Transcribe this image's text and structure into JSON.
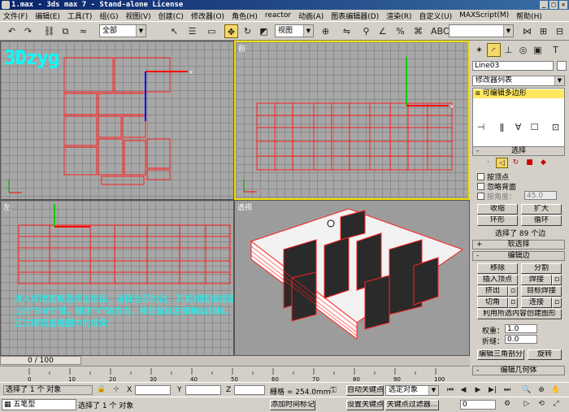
{
  "window": {
    "title": "1.max - 3ds max 7 - Stand-alone License"
  },
  "menu": [
    "文件(F)",
    "编辑(E)",
    "工具(T)",
    "组(G)",
    "视图(V)",
    "创建(C)",
    "修改器(O)",
    "角色(H)",
    "reactor",
    "动画(A)",
    "图表编辑器(D)",
    "渲染(R)",
    "自定义(U)",
    "MAXScript(M)",
    "帮助(H)"
  ],
  "toolbar": {
    "selection_filter": "全部",
    "coord_system": "视图"
  },
  "viewports": {
    "top_label": "",
    "front_label": "前",
    "left_label": "左",
    "persp_label": "透视"
  },
  "logo": "3Dzyg",
  "overlay_text": "进入修改面板选择边层级，选择全部的边，到前视图按住键盘上的\"Shift\"键，锁定\"Y\"轴方向，按住鼠标左键拖动鼠标，托五次得到透视图中的效果!",
  "panel": {
    "object_name": "Line03",
    "modifier_list": "修改器列表",
    "stack_item": "可编辑多边形",
    "selection": {
      "title": "选择",
      "by_vertex": "按顶点",
      "ignore_backfacing": "忽略背面",
      "by_angle": "按角度：",
      "angle_value": "45.0",
      "shrink": "收缩",
      "grow": "扩大",
      "ring": "环形",
      "loop": "循环",
      "status": "选择了 89 个边"
    },
    "soft_selection": "软选择",
    "edit_edges": {
      "title": "编辑边",
      "remove": "移除",
      "split": "分割",
      "insert_vertex": "插入顶点",
      "weld": "焊接",
      "extrude": "挤出",
      "target_weld": "目标焊接",
      "chamfer": "切角",
      "connect": "连接",
      "create_shape": "利用所选内容创建图形",
      "weight_label": "权重：",
      "weight_value": "1.0",
      "crease_label": "折缝：",
      "crease_value": "0.0",
      "edit_tri": "编辑三角剖分",
      "turn": "旋转"
    },
    "edit_geometry": "编辑几何体"
  },
  "timeline": {
    "position": "0 / 100",
    "ticks": [
      "0",
      "10",
      "20",
      "30",
      "40",
      "50",
      "60",
      "70",
      "80",
      "90",
      "100"
    ]
  },
  "status": {
    "selected": "选择了 1 个 对象",
    "x_label": "X",
    "y_label": "Y",
    "z_label": "Z",
    "grid": "栅格 = 254.0mm",
    "auto_key": "自动关键点",
    "selected_set": "选定对象",
    "set_key": "设置关键点",
    "key_filters": "关键点过滤器...",
    "add_time_tag": "添加时间标记",
    "frame": "0",
    "prompt": "选择了 1 个 对象",
    "ime": "五笔型"
  },
  "colors": {
    "lines": "#ff2020",
    "active": "#f0e000",
    "overlay": "#00ffff"
  }
}
